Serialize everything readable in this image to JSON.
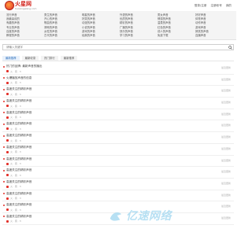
{
  "header": {
    "logo_text": "火星网",
    "logo_sub": "huoxingwang.com",
    "links": [
      "登录/注册",
      "注册帐号",
      "我的"
    ]
  },
  "nav": {
    "items": [
      "流行声音",
      "男生的声音",
      "明星的声音",
      "外语的声音",
      "男女声音",
      "好好声音",
      "我最喜欢的",
      "开心的声音",
      "好笑的声音",
      "优质的声音",
      "情感的声音",
      "体育声音",
      "有趣的声音",
      "歌曲的声音",
      "动漫的声音",
      "精彩的声音",
      "温柔的声音",
      "动作声音",
      "专业的声音",
      "清晰的声音",
      "小说的声音",
      "广播的声音",
      "红色的声音",
      "游戏声音",
      "百度的声音",
      "女性的声音",
      "游戏的声音",
      "快乐的声音",
      "成人的声音",
      "搞笑的声音",
      "教程的声音",
      "古代的声音",
      "经典的声音",
      "学习的声音",
      "免费下载",
      "连播声音"
    ]
  },
  "search": {
    "placeholder": "请输入关键字"
  },
  "tabs": [
    "最新推荐",
    "最新收录",
    "热门排行",
    "最新推荐"
  ],
  "rows": [
    {
      "title": "热门的品牌: 最新声音的播出",
      "meta": "火 · 音 · 3",
      "date": "最近更新"
    },
    {
      "title": "火爆播放声音的信息",
      "meta": "火 · 音 · 3",
      "date": "最近更新"
    },
    {
      "title": "高度关注的精彩声音",
      "meta": "火 · 音 · 3",
      "date": "最近更新"
    },
    {
      "title": "高度关注的精彩声音",
      "meta": "火 · 音 · 3",
      "date": "最近更新"
    },
    {
      "title": "高度关注的精彩声音",
      "meta": "火 · 音 · 3",
      "date": "最近更新"
    },
    {
      "title": "高度关注的精彩声音",
      "meta": "火 · 音 · 3",
      "date": "最近更新"
    },
    {
      "title": "高度关注的精彩声音",
      "meta": "火 · 音 · 3",
      "date": "最近更新"
    },
    {
      "title": "高度关注的精彩声音",
      "meta": "火 · 音 · 3",
      "date": "最近更新"
    },
    {
      "title": "高度关注的精彩声音",
      "meta": "火 · 音 · 3",
      "date": "最近更新"
    },
    {
      "title": "高度关注的精彩声音",
      "meta": "火 · 音 · 3",
      "date": "最近更新"
    },
    {
      "title": "高度关注的精彩声音",
      "meta": "火 · 音 · 3",
      "date": "最近更新"
    },
    {
      "title": "高度关注的精彩声音",
      "meta": "火 · 音 · 3",
      "date": "最近更新"
    },
    {
      "title": "高度关注的精彩声音",
      "meta": "火 · 音 · 3",
      "date": "最近更新"
    },
    {
      "title": "高度关注的精彩声音",
      "meta": "火 · 音 · 3",
      "date": "最近更新"
    }
  ],
  "watermark": {
    "text": "亿速网络"
  },
  "colors": {
    "accent": "#2a6ebb",
    "brand": "#e2312a",
    "watermark": "#9fd6ef"
  }
}
